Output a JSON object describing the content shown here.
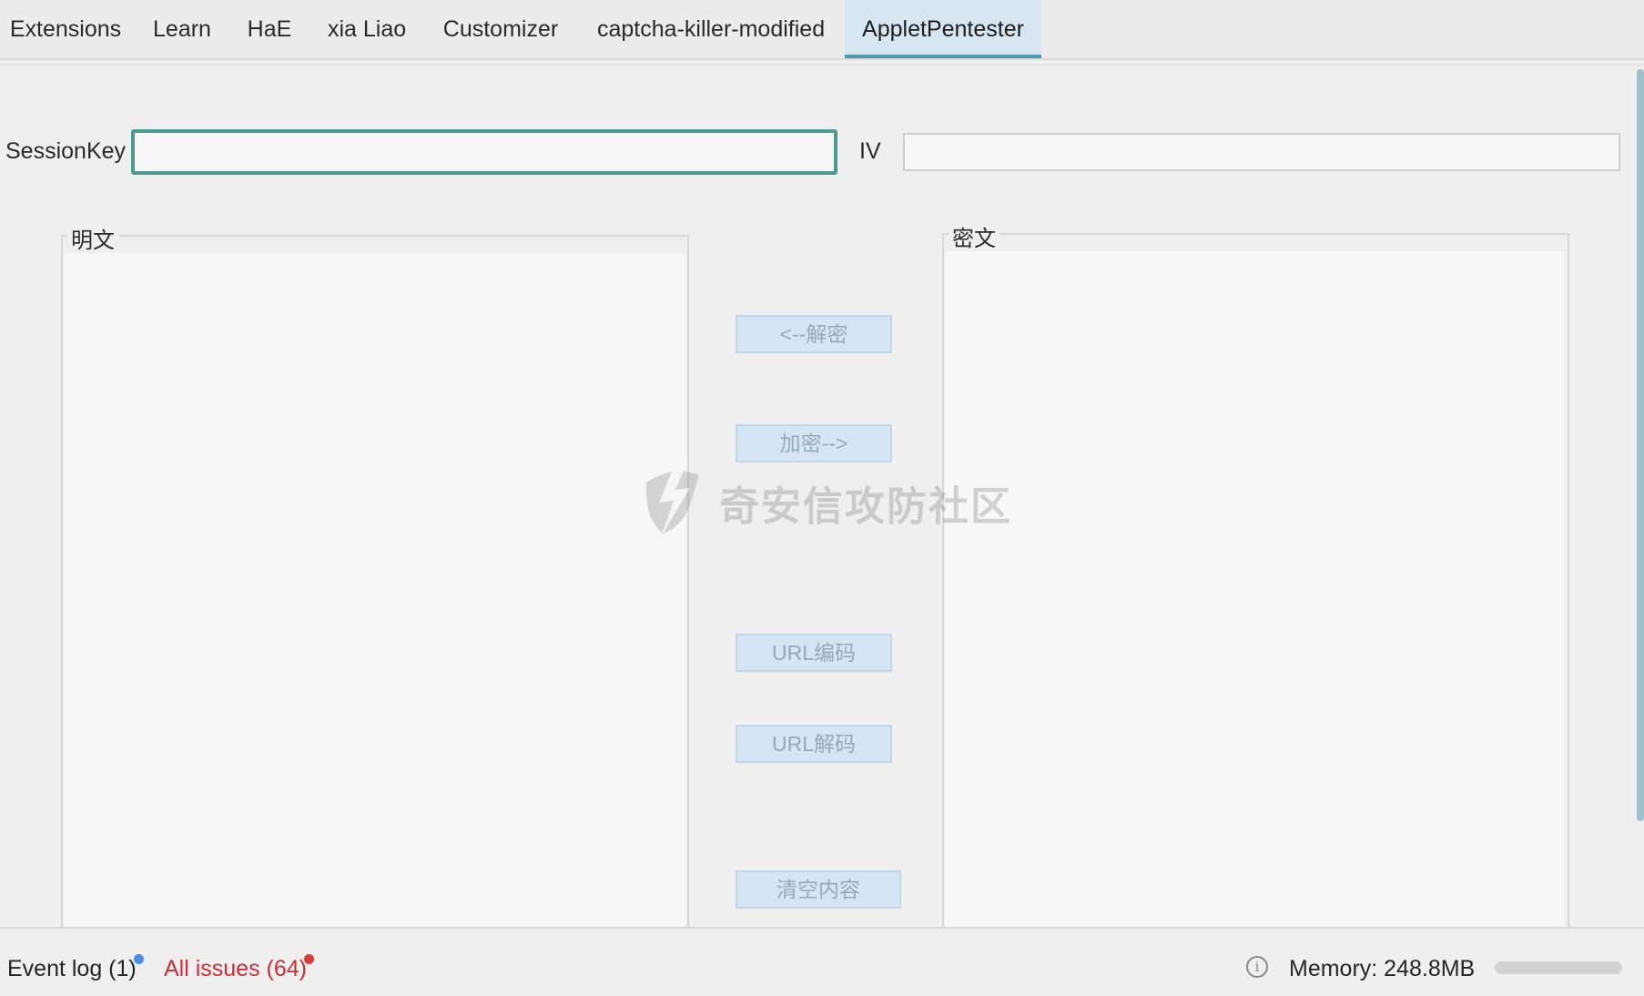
{
  "tabs": [
    {
      "label": "Extensions",
      "active": false
    },
    {
      "label": "Learn",
      "active": false
    },
    {
      "label": "HaE",
      "active": false
    },
    {
      "label": "xia Liao",
      "active": false
    },
    {
      "label": "Customizer",
      "active": false
    },
    {
      "label": "captcha-killer-modified",
      "active": false
    },
    {
      "label": "AppletPentester",
      "active": true
    }
  ],
  "form": {
    "session_key_label": "SessionKey",
    "session_key_value": "",
    "iv_label": "IV",
    "iv_value": ""
  },
  "panels": {
    "plaintext_title": "明文",
    "plaintext_value": "",
    "ciphertext_title": "密文",
    "ciphertext_value": ""
  },
  "actions": {
    "decrypt": "<--解密",
    "encrypt": "加密-->",
    "url_encode": "URL编码",
    "url_decode": "URL解码",
    "clear": "清空内容"
  },
  "watermark": {
    "text": "奇安信攻防社区"
  },
  "status": {
    "event_log": "Event log (1)",
    "all_issues": "All issues (64)",
    "memory": "Memory: 248.8MB",
    "info_icon": "info-icon"
  },
  "colors": {
    "accent": "#4b9cad",
    "focus_border": "#4c9a92",
    "button_bg": "#d6e5f3",
    "event_dot": "#4a8ee8",
    "issues_red": "#cc2e3a",
    "issues_dot": "#d83b3b"
  }
}
